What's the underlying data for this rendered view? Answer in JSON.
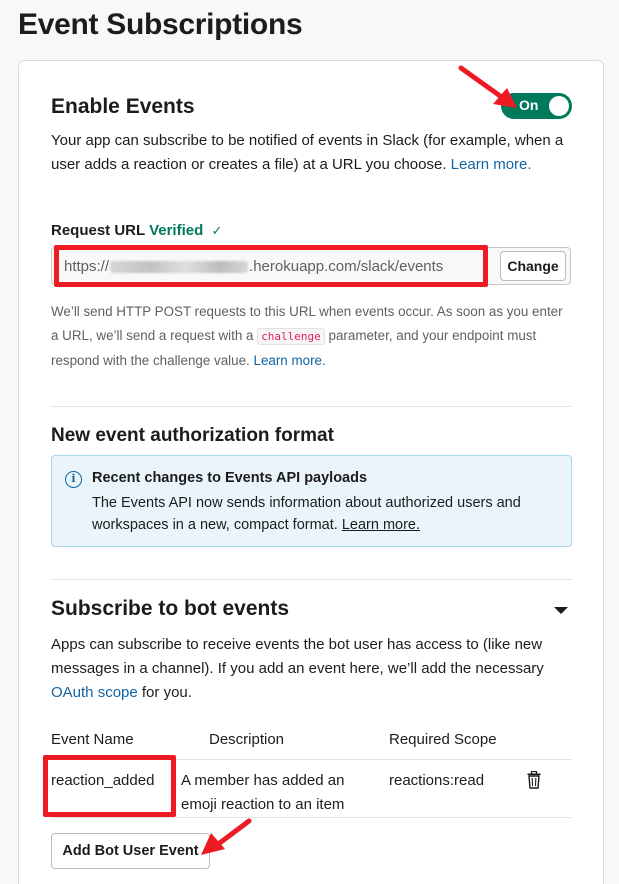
{
  "page_title": "Event Subscriptions",
  "enable_events": {
    "heading": "Enable Events",
    "toggle_label": "On",
    "description_prefix": "Your app can subscribe to be notified of events in Slack (for example, when a user adds a reaction or creates a file) at a URL you choose.",
    "learn_more": "Learn more.",
    "request_url_label": "Request URL",
    "verified_label": "Verified",
    "check_glyph": "✓",
    "url_prefix": "https://",
    "url_suffix": ".herokuapp.com/slack/events",
    "change_button": "Change",
    "help_part1": "We’ll send HTTP POST requests to this URL when events occur. As soon as you enter a URL, we’ll send a request with a",
    "help_code": "challenge",
    "help_part2": "parameter, and your endpoint must respond with the challenge value.",
    "help_learn_more": "Learn more."
  },
  "auth_format": {
    "heading": "New event authorization format",
    "info_title": "Recent changes to Events API payloads",
    "info_body": "The Events API now sends information about authorized users and workspaces in a new, compact format.",
    "info_link": "Learn more."
  },
  "bot_events": {
    "heading": "Subscribe to bot events",
    "description": "Apps can subscribe to receive events the bot user has access to (like new messages in a channel). If you add an event here, we’ll add the necessary",
    "oauth_link": "OAuth scope",
    "description_suffix": "for you.",
    "columns": [
      "Event Name",
      "Description",
      "Required Scope"
    ],
    "rows": [
      {
        "name": "reaction_added",
        "description": "A member has added an emoji reaction to an item",
        "scope": "reactions:read"
      }
    ],
    "add_button": "Add Bot User Event"
  },
  "icons": {
    "info": "info-icon",
    "trash": "trash-icon",
    "caret": "caret-down-icon"
  },
  "colors": {
    "toggle_on": "#007a5a",
    "link": "#1264a3",
    "annotation_red": "#ee1b24",
    "info_bg": "#eaf5fb"
  }
}
